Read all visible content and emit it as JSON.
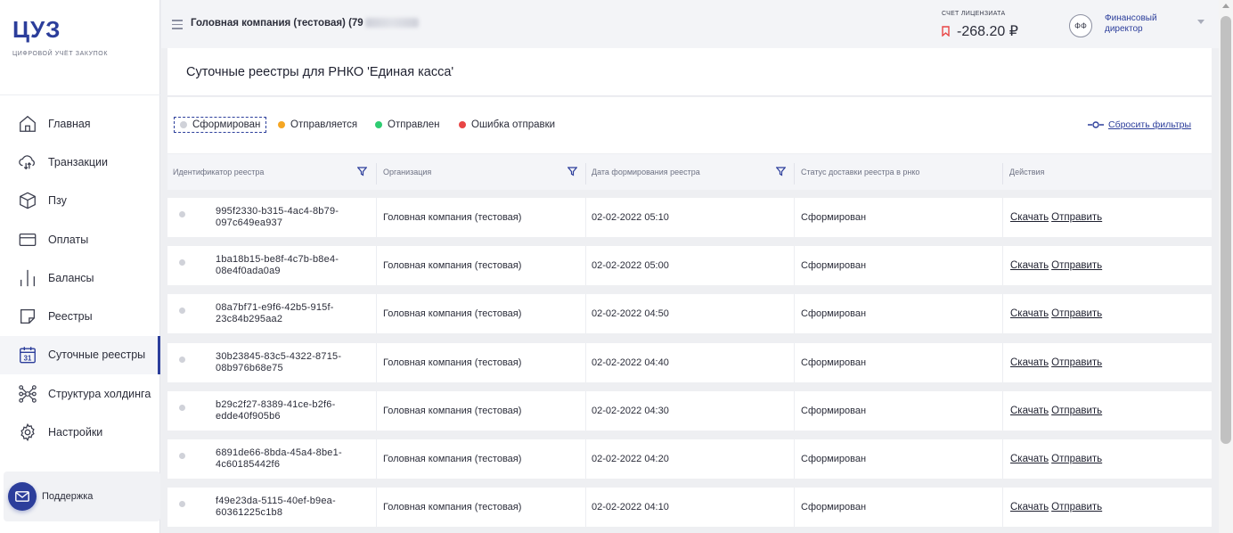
{
  "sidebar": {
    "logo": "ЦУЗ",
    "logo_subtitle": "ЦИФРОВОЙ УЧЁТ ЗАКУПОК",
    "items": [
      {
        "label": "Главная",
        "icon": "home-icon"
      },
      {
        "label": "Транзакции",
        "icon": "transactions-icon"
      },
      {
        "label": "Пзу",
        "icon": "box-icon"
      },
      {
        "label": "Оплаты",
        "icon": "card-icon"
      },
      {
        "label": "Балансы",
        "icon": "bars-icon"
      },
      {
        "label": "Реестры",
        "icon": "document-icon"
      },
      {
        "label": "Суточные реестры",
        "icon": "calendar-icon",
        "active": true
      },
      {
        "label": "Структура холдинга",
        "icon": "structure-icon"
      },
      {
        "label": "Настройки",
        "icon": "gear-icon"
      }
    ],
    "calendar_number": "31",
    "support_label": "Поддержка"
  },
  "topbar": {
    "company": "Головная компания (тестовая) (79",
    "account_label": "СЧЕТ ЛИЦЕНЗИАТА",
    "account_value": "-268.20 ₽",
    "avatar_initials": "ФФ",
    "role": "Финансовый директор"
  },
  "page": {
    "title": "Суточные реестры для РНКО 'Единая касса'"
  },
  "filters": {
    "statuses": [
      {
        "label": "Сформирован",
        "color": "#d0d2d9",
        "selected": true
      },
      {
        "label": "Отправляется",
        "color": "#f5a623",
        "selected": false
      },
      {
        "label": "Отправлен",
        "color": "#2ecc71",
        "selected": false
      },
      {
        "label": "Ошибка отправки",
        "color": "#e84545",
        "selected": false
      }
    ],
    "reset_label": "Сбросить фильтры"
  },
  "table": {
    "columns": [
      "Идентификатор реестра",
      "Организация",
      "Дата формирования реестра",
      "Статус доставки реестра в рнко",
      "Действия"
    ],
    "download_label": "Скачать",
    "send_label": "Отправить",
    "rows": [
      {
        "id": "995f2330-b315-4ac4-8b79-097c649ea937",
        "org": "Головная компания (тестовая)",
        "date": "02-02-2022 05:10",
        "status": "Сформирован"
      },
      {
        "id": "1ba18b15-be8f-4c7b-b8e4-08e4f0ada0a9",
        "org": "Головная компания (тестовая)",
        "date": "02-02-2022 05:00",
        "status": "Сформирован"
      },
      {
        "id": "08a7bf71-e9f6-42b5-915f-23c84b295aa2",
        "org": "Головная компания (тестовая)",
        "date": "02-02-2022 04:50",
        "status": "Сформирован"
      },
      {
        "id": "30b23845-83c5-4322-8715-08b976b68e75",
        "org": "Головная компания (тестовая)",
        "date": "02-02-2022 04:40",
        "status": "Сформирован"
      },
      {
        "id": "b29c2f27-8389-41ce-b2f6-edde40f905b6",
        "org": "Головная компания (тестовая)",
        "date": "02-02-2022 04:30",
        "status": "Сформирован"
      },
      {
        "id": "6891de66-8bda-45a4-8be1-4c60185442f6",
        "org": "Головная компания (тестовая)",
        "date": "02-02-2022 04:20",
        "status": "Сформирован"
      },
      {
        "id": "f49e23da-5115-40ef-b9ea-60361225c1b8",
        "org": "Головная компания (тестовая)",
        "date": "02-02-2022 04:10",
        "status": "Сформирован"
      }
    ]
  },
  "colors": {
    "brand": "#2c3e9b",
    "status_formed": "#d0d2d9",
    "status_sending": "#f5a623",
    "status_sent": "#2ecc71",
    "status_error": "#e84545",
    "negative_balance": "#e84545"
  }
}
